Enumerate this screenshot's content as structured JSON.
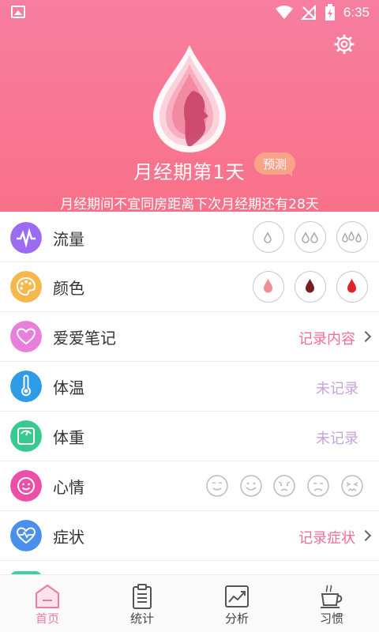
{
  "status_bar": {
    "time": "6:35"
  },
  "header": {
    "title": "月经期第1天",
    "badge": "预测",
    "subtitle": "月经期间不宜同房距离下次月经期还有28天",
    "settings_icon": "gear-icon"
  },
  "rows": [
    {
      "key": "flow",
      "label": "流量",
      "icon": "waveform-icon",
      "color": "#9b6cf2"
    },
    {
      "key": "color",
      "label": "颜色",
      "icon": "palette-icon",
      "color": "#f5b84d",
      "options": [
        "#f08f8f",
        "#7a1f1f",
        "#e3212b"
      ]
    },
    {
      "key": "love",
      "label": "爱爱笔记",
      "icon": "heart-icon",
      "color": "#e97fdc",
      "action": "记录内容"
    },
    {
      "key": "temp",
      "label": "体温",
      "icon": "thermometer-icon",
      "color": "#2d9be6",
      "value": "未记录"
    },
    {
      "key": "weight",
      "label": "体重",
      "icon": "scale-icon",
      "color": "#38c98e",
      "value": "未记录"
    },
    {
      "key": "mood",
      "label": "心情",
      "icon": "smiley-icon",
      "color": "#ec4fa8"
    },
    {
      "key": "symptom",
      "label": "症状",
      "icon": "heartbeat-icon",
      "color": "#4a8fec",
      "action": "记录症状"
    }
  ],
  "nav": [
    {
      "label": "首页",
      "icon": "home-icon",
      "active": true
    },
    {
      "label": "统计",
      "icon": "clipboard-icon",
      "active": false
    },
    {
      "label": "分析",
      "icon": "chart-icon",
      "active": false
    },
    {
      "label": "习惯",
      "icon": "cup-icon",
      "active": false
    }
  ],
  "colors": {
    "accent": "#f26d93",
    "header": "#f77ea0",
    "muted": "#c7a3d9"
  }
}
